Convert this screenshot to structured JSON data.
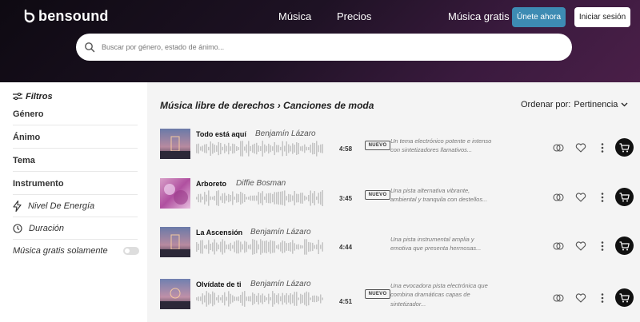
{
  "header": {
    "brand": "bensound",
    "nav": [
      "Música",
      "Precios"
    ],
    "free_music": "Música gratis",
    "join_label": "Únete ahora",
    "login_label": "Iniciar sesión",
    "search_placeholder": "Buscar por género, estado de ánimo..."
  },
  "sidebar": {
    "title": "Filtros",
    "items": [
      "Género",
      "Ánimo",
      "Tema",
      "Instrumento"
    ],
    "energy": "Nivel De Energía",
    "duration": "Duración",
    "free_only": "Música gratis solamente"
  },
  "main": {
    "breadcrumb": "Música libre de derechos › Canciones de moda",
    "sort_label": "Ordenar por:",
    "sort_value": "Pertinencia"
  },
  "tracks": [
    {
      "title": "Todo está aquí",
      "artist": "Benjamín Lázaro",
      "duration": "4:58",
      "badge": "NUEVO",
      "desc1": "Un tema electrónico potente e intenso",
      "desc2": "con sintetizadores llamativos..."
    },
    {
      "title": "Arboreto",
      "artist": "Diffie Bosman",
      "duration": "3:45",
      "badge": "NUEVO",
      "desc1": "Una pista alternativa vibrante,",
      "desc2": "ambiental y tranquila con destellos..."
    },
    {
      "title": "La Ascensión",
      "artist": "Benjamín Lázaro",
      "duration": "4:44",
      "badge": "",
      "desc1": "Una pista instrumental amplia y",
      "desc2": "emotiva que presenta hermosas..."
    },
    {
      "title": "Olvídate de ti",
      "artist": "Benjamín Lázaro",
      "duration": "4:51",
      "badge": "NUEVO",
      "desc1": "Una evocadora pista electrónica que",
      "desc2": "combina dramáticas capas de",
      "desc3": "sintetizador..."
    }
  ],
  "colors": {
    "accent": "#3d8bb3",
    "cart": "#111111"
  }
}
